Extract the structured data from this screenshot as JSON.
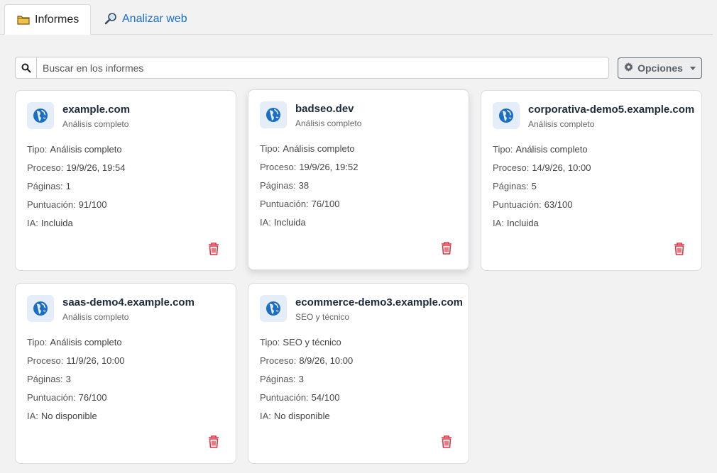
{
  "tabs": [
    {
      "label": "Informes",
      "icon": "folder-icon",
      "active": true
    },
    {
      "label": "Analizar web",
      "icon": "magnifier-icon",
      "active": false
    }
  ],
  "search": {
    "placeholder": "Buscar en los informes",
    "value": ""
  },
  "options": {
    "label": "Opciones"
  },
  "labels": {
    "tipo": "Tipo:",
    "proceso": "Proceso:",
    "paginas": "Páginas:",
    "puntuacion": "Puntuación:",
    "ia": "IA:"
  },
  "colors": {
    "accent": "#1b6ec2",
    "danger": "#dc3545",
    "globe": "#1b6ec2"
  },
  "cards": [
    {
      "title": "example.com",
      "subtitle": "Análisis completo",
      "tipo": "Análisis completo",
      "proceso": "19/9/26, 19:54",
      "paginas": "1",
      "puntuacion": "91/100",
      "ia": "Incluida"
    },
    {
      "title": "badseo.dev",
      "subtitle": "Análisis completo",
      "tipo": "Análisis completo",
      "proceso": "19/9/26, 19:52",
      "paginas": "38",
      "puntuacion": "76/100",
      "ia": "Incluida"
    },
    {
      "title": "corporativa-demo5.example.com",
      "subtitle": "Análisis completo",
      "tipo": "Análisis completo",
      "proceso": "14/9/26, 10:00",
      "paginas": "5",
      "puntuacion": "63/100",
      "ia": "Incluida"
    },
    {
      "title": "saas-demo4.example.com",
      "subtitle": "Análisis completo",
      "tipo": "Análisis completo",
      "proceso": "11/9/26, 10:00",
      "paginas": "3",
      "puntuacion": "76/100",
      "ia": "No disponible"
    },
    {
      "title": "ecommerce-demo3.example.com",
      "subtitle": "SEO y técnico",
      "tipo": "SEO y técnico",
      "proceso": "8/9/26, 10:00",
      "paginas": "3",
      "puntuacion": "54/100",
      "ia": "No disponible"
    }
  ]
}
